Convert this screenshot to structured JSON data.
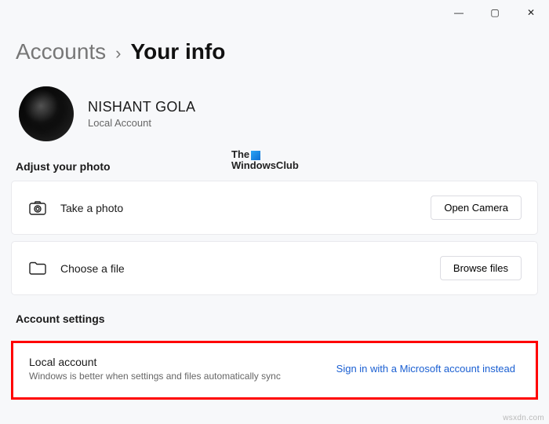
{
  "window_controls": {
    "minimize": "—",
    "maximize": "▢",
    "close": "✕"
  },
  "breadcrumb": {
    "parent": "Accounts",
    "separator": "›",
    "current": "Your info"
  },
  "profile": {
    "name": "NISHANT GOLA",
    "account_type": "Local Account"
  },
  "watermark": {
    "line1": "The",
    "line2": "WindowsClub"
  },
  "sections": {
    "photo_heading": "Adjust your photo",
    "account_settings_heading": "Account settings"
  },
  "photo_rows": [
    {
      "label": "Take a photo",
      "button": "Open Camera"
    },
    {
      "label": "Choose a file",
      "button": "Browse files"
    }
  ],
  "account_row": {
    "title": "Local account",
    "desc": "Windows is better when settings and files automatically sync",
    "link": "Sign in with a Microsoft account instead"
  },
  "footer": "wsxdn.com"
}
